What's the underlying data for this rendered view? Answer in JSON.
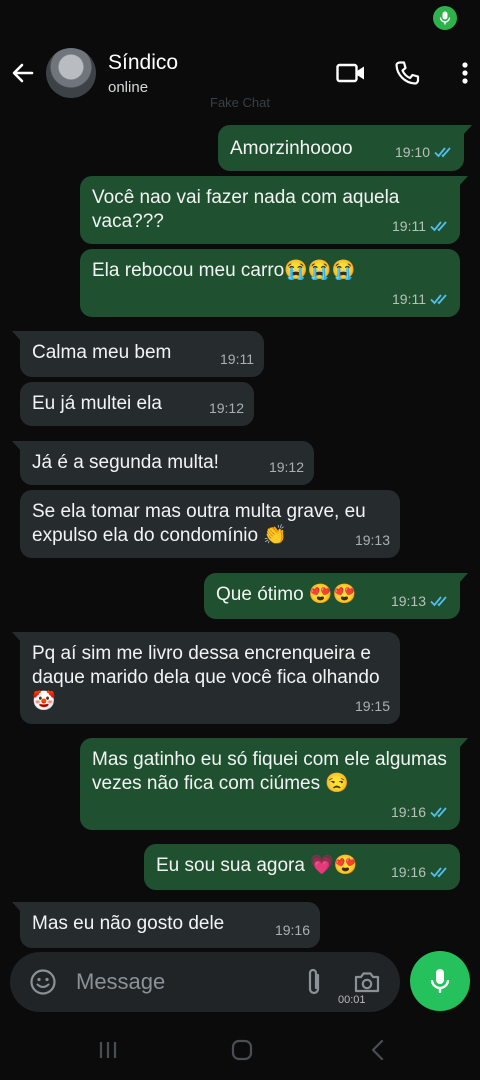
{
  "header": {
    "contact_name": "Síndico",
    "contact_status": "online"
  },
  "watermark": "Fake Chat",
  "icons": {
    "back": "arrow-left-icon",
    "video": "video-call-icon",
    "voice": "phone-icon",
    "menu": "more-vertical-icon",
    "emoji": "emoji-icon",
    "attach": "paperclip-icon",
    "camera": "camera-icon",
    "mic": "microphone-icon",
    "read": "double-check-icon"
  },
  "colors": {
    "outgoing_bubble": "#1f5130",
    "incoming_bubble": "#262b2e",
    "read_ticks": "#53bdeb",
    "mic_button": "#25c15c"
  },
  "messages": [
    {
      "direction": "out",
      "text": "Amorzinhoooo",
      "time": "19:10",
      "read": true
    },
    {
      "direction": "out",
      "text": "Você nao vai fazer nada com aquela vaca???",
      "time": "19:11",
      "read": true
    },
    {
      "direction": "out",
      "text": "Ela rebocou meu carro😭😭😭",
      "time": "19:11",
      "read": true
    },
    {
      "direction": "in",
      "text": "Calma meu bem",
      "time": "19:11"
    },
    {
      "direction": "in",
      "text": "Eu já multei ela",
      "time": "19:12"
    },
    {
      "direction": "in",
      "text": "Já é a segunda multa!",
      "time": "19:12"
    },
    {
      "direction": "in",
      "text": "Se ela tomar mas outra multa grave, eu expulso ela do condomínio 👏",
      "time": "19:13"
    },
    {
      "direction": "out",
      "text": "Que ótimo 😍😍",
      "time": "19:13",
      "read": true
    },
    {
      "direction": "in",
      "text": "Pq aí sim me livro dessa encrenqueira e daque marido dela que você fica olhando 🤡",
      "time": "19:15"
    },
    {
      "direction": "out",
      "text": "Mas gatinho eu só fiquei com ele algumas vezes não fica com ciúmes 😒",
      "time": "19:16",
      "read": true
    },
    {
      "direction": "out",
      "text": "Eu sou sua agora 💗😍",
      "time": "19:16",
      "read": true
    },
    {
      "direction": "in",
      "text": "Mas eu não gosto dele",
      "time": "19:16"
    }
  ],
  "composer": {
    "placeholder": "Message",
    "recording_timer": "00:01"
  }
}
